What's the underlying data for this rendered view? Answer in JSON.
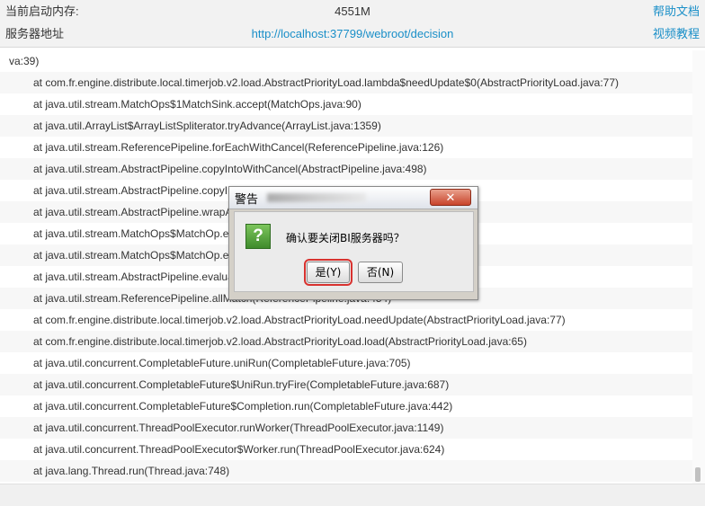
{
  "header": {
    "memory_label": "当前启动内存:",
    "memory_value": "4551M",
    "help_link": "帮助文档",
    "server_label": "服务器地址",
    "server_url": "http://localhost:37799/webroot/decision",
    "video_link": "视频教程"
  },
  "log_lines": [
    "va:39)",
    "at com.fr.engine.distribute.local.timerjob.v2.load.AbstractPriorityLoad.lambda$needUpdate$0(AbstractPriorityLoad.java:77)",
    "at java.util.stream.MatchOps$1MatchSink.accept(MatchOps.java:90)",
    "at java.util.ArrayList$ArrayListSpliterator.tryAdvance(ArrayList.java:1359)",
    "at java.util.stream.ReferencePipeline.forEachWithCancel(ReferencePipeline.java:126)",
    "at java.util.stream.AbstractPipeline.copyIntoWithCancel(AbstractPipeline.java:498)",
    "at java.util.stream.AbstractPipeline.copyInto(AbstractPipeline.java:485)",
    "at java.util.stream.AbstractPipeline.wrapAndCopyInto(AbstractPipeline.java:471)",
    "at java.util.stream.MatchOps$MatchOp.evaluateSequential(MatchOps.java:230)",
    "at java.util.stream.MatchOps$MatchOp.evaluateSequential(MatchOps.java:196)",
    "at java.util.stream.AbstractPipeline.evaluate(AbstractPipeline.java:234)",
    "at java.util.stream.ReferencePipeline.allMatch(ReferencePipeline.java:454)",
    "at com.fr.engine.distribute.local.timerjob.v2.load.AbstractPriorityLoad.needUpdate(AbstractPriorityLoad.java:77)",
    "at com.fr.engine.distribute.local.timerjob.v2.load.AbstractPriorityLoad.load(AbstractPriorityLoad.java:65)",
    "at java.util.concurrent.CompletableFuture.uniRun(CompletableFuture.java:705)",
    "at java.util.concurrent.CompletableFuture$UniRun.tryFire(CompletableFuture.java:687)",
    "at java.util.concurrent.CompletableFuture$Completion.run(CompletableFuture.java:442)",
    "at java.util.concurrent.ThreadPoolExecutor.runWorker(ThreadPoolExecutor.java:1149)",
    "at java.util.concurrent.ThreadPoolExecutor$Worker.run(ThreadPoolExecutor.java:624)",
    "at java.lang.Thread.run(Thread.java:748)"
  ],
  "dialog": {
    "title": "警告",
    "close_icon": "close-icon",
    "question_icon": "question-icon",
    "message": "确认要关闭BI服务器吗？",
    "yes_label": "是(Y)",
    "no_label": "否(N)"
  }
}
